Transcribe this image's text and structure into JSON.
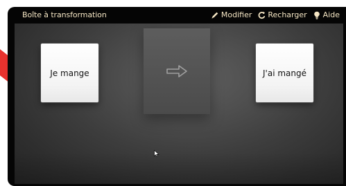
{
  "window": {
    "title": "Boîte à transformation"
  },
  "toolbar": {
    "modify": "Modifier",
    "reload": "Recharger",
    "help": "Aide"
  },
  "icons": {
    "modify": "pencil-icon",
    "reload": "reload-icon",
    "help": "lightbulb-icon",
    "arrow": "right-arrow-icon",
    "cursor": "mouse-pointer-icon"
  },
  "cards": {
    "input": "Je mange",
    "output": "J'ai mangé"
  },
  "colors": {
    "frame": "#050505",
    "toolbar_text": "#f6e7c5",
    "card": "#f7f7f7",
    "canvas": "#464646",
    "accent": "#e8322e"
  }
}
